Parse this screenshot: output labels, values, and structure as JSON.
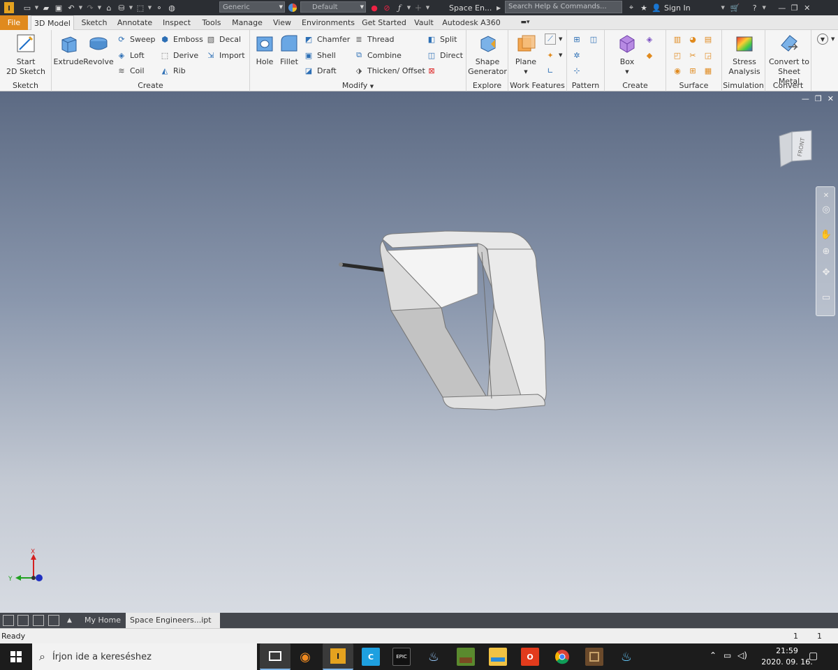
{
  "titlebar": {
    "appearance_combo": "Generic",
    "material_combo": "Default",
    "doc_title": "Space En...",
    "search_placeholder": "Search Help & Commands...",
    "sign_in": "Sign In"
  },
  "tabs": [
    "File",
    "3D Model",
    "Sketch",
    "Annotate",
    "Inspect",
    "Tools",
    "Manage",
    "View",
    "Environments",
    "Get Started",
    "Vault",
    "Autodesk A360"
  ],
  "ribbon": {
    "sketch": {
      "title": "Sketch",
      "start": "Start",
      "start2": "2D Sketch"
    },
    "create": {
      "title": "Create",
      "extrude": "Extrude",
      "revolve": "Revolve",
      "sweep": "Sweep",
      "loft": "Loft",
      "coil": "Coil",
      "emboss": "Emboss",
      "derive": "Derive",
      "rib": "Rib",
      "decal": "Decal",
      "import": "Import"
    },
    "modify": {
      "title": "Modify",
      "hole": "Hole",
      "fillet": "Fillet",
      "chamfer": "Chamfer",
      "shell": "Shell",
      "draft": "Draft",
      "thread": "Thread",
      "combine": "Combine",
      "thicken": "Thicken/ Offset",
      "split": "Split",
      "direct": "Direct"
    },
    "explore": {
      "title": "Explore",
      "shape1": "Shape",
      "shape2": "Generator"
    },
    "work": {
      "title": "Work Features",
      "plane": "Plane"
    },
    "pattern": {
      "title": "Pattern"
    },
    "freeform": {
      "title": "Create Freeform",
      "box": "Box"
    },
    "surface": {
      "title": "Surface"
    },
    "simulation": {
      "title": "Simulation",
      "stress1": "Stress",
      "stress2": "Analysis"
    },
    "convert": {
      "title": "Convert",
      "c1": "Convert to",
      "c2": "Sheet Metal"
    }
  },
  "viewcube": {
    "face": "FRONT"
  },
  "axis": {
    "x": "X",
    "y": "Y"
  },
  "doctabs": {
    "home": "My Home",
    "doc": "Space Engineers...ipt",
    "close": "✕"
  },
  "status": {
    "text": "Ready",
    "n1": "1",
    "n2": "1"
  },
  "taskbar": {
    "search": "Írjon ide a kereséshez",
    "time": "21:59",
    "date": "2020. 09. 16."
  },
  "colors": {
    "file_tab": "#e08a1e",
    "titlebar": "#2b2e33",
    "ribbon": "#f5f5f5",
    "taskbar": "#1c1c1c"
  }
}
